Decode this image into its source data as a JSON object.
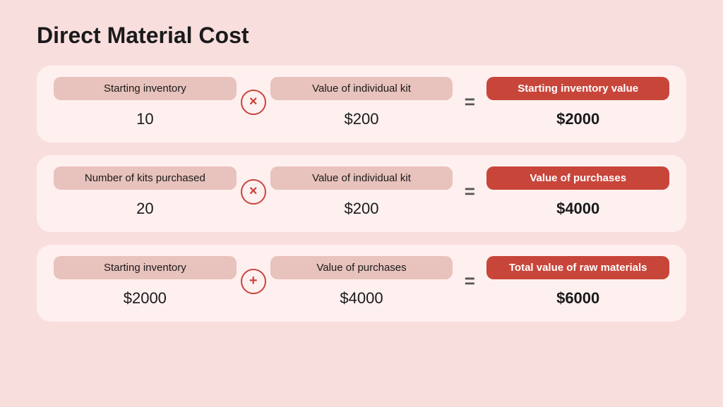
{
  "title": "Direct Material Cost",
  "rows": [
    {
      "cells": [
        {
          "label": "Starting inventory",
          "value": "10",
          "highlight": false,
          "bold": false
        },
        {
          "operator": "×"
        },
        {
          "label": "Value of individual kit",
          "value": "$200",
          "highlight": false,
          "bold": false
        },
        {
          "equals": "="
        },
        {
          "label": "Starting inventory value",
          "value": "$2000",
          "highlight": true,
          "bold": true
        }
      ]
    },
    {
      "cells": [
        {
          "label": "Number of kits purchased",
          "value": "20",
          "highlight": false,
          "bold": false
        },
        {
          "operator": "×"
        },
        {
          "label": "Value of individual kit",
          "value": "$200",
          "highlight": false,
          "bold": false
        },
        {
          "equals": "="
        },
        {
          "label": "Value of purchases",
          "value": "$4000",
          "highlight": true,
          "bold": true
        }
      ]
    },
    {
      "cells": [
        {
          "label": "Starting inventory",
          "value": "$2000",
          "highlight": false,
          "bold": false
        },
        {
          "operator": "+"
        },
        {
          "label": "Value of purchases",
          "value": "$4000",
          "highlight": false,
          "bold": false
        },
        {
          "equals": "="
        },
        {
          "label": "Total value of raw materials",
          "value": "$6000",
          "highlight": true,
          "bold": true
        }
      ]
    }
  ]
}
